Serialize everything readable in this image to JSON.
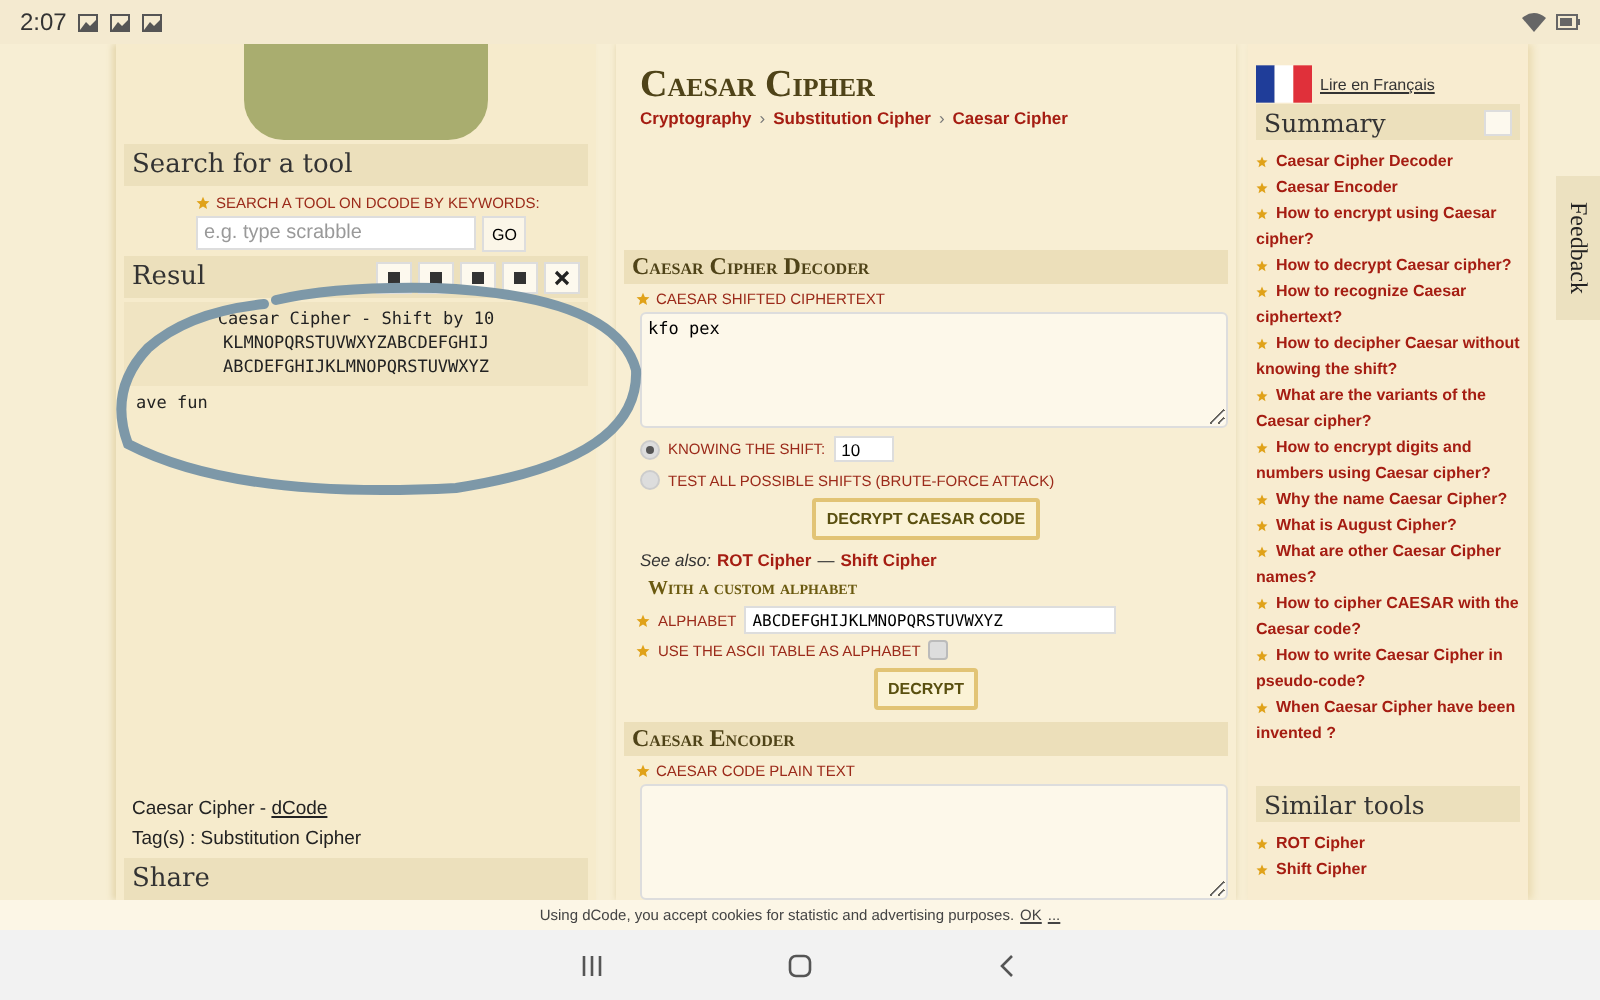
{
  "status_bar": {
    "time": "2:07"
  },
  "left": {
    "search": {
      "title": "Search for a tool",
      "label": "SEARCH A TOOL ON DCODE BY KEYWORDS:",
      "placeholder": "e.g. type scrabble",
      "button": "GO"
    },
    "results": {
      "title": "Resul",
      "output_lines": [
        "Caesar Cipher - Shift by 10",
        "KLMNOPQRSTUVWXYZABCDEFGHIJ",
        "ABCDEFGHIJKLMNOPQRSTUVWXYZ"
      ],
      "note": "ave fun"
    },
    "footer": {
      "text": "Caesar Cipher - ",
      "link": "dCode",
      "tags": "Tag(s) : Substitution Cipher"
    },
    "share": {
      "title": "Share"
    }
  },
  "main": {
    "title": "Caesar Cipher",
    "breadcrumb": [
      "Cryptography",
      "Substitution Cipher",
      "Caesar Cipher"
    ],
    "breadcrumb_separator": "›",
    "decoder": {
      "title": "Caesar Cipher Decoder",
      "ciphertext_label": "CAESAR SHIFTED CIPHERTEXT",
      "ciphertext_value": "kfo pex",
      "shift_options": [
        {
          "label": "KNOWING THE SHIFT:",
          "selected": true,
          "value": "10"
        },
        {
          "label": "TEST ALL POSSIBLE SHIFTS (BRUTE-FORCE ATTACK)",
          "selected": false
        }
      ],
      "button": "DECRYPT CAESAR CODE",
      "see_also_label": "See also:",
      "see_also_links": [
        "ROT Cipher",
        "Shift Cipher"
      ],
      "see_also_separator": "—",
      "custom_title": "With a custom alphabet",
      "alphabet_label": "ALPHABET",
      "alphabet_value": "ABCDEFGHIJKLMNOPQRSTUVWXYZ",
      "ascii_label": "USE THE ASCII TABLE AS ALPHABET",
      "ascii_checked": false,
      "custom_button": "DECRYPT"
    },
    "encoder": {
      "title": "Caesar Encoder",
      "label": "CAESAR CODE PLAIN TEXT"
    }
  },
  "right": {
    "language_link": "Lire en Français",
    "summary": {
      "title": "Summary",
      "items": [
        "Caesar Cipher Decoder",
        "Caesar Encoder",
        "How to encrypt using Caesar cipher?",
        "How to decrypt Caesar cipher?",
        "How to recognize Caesar ciphertext?",
        "How to decipher Caesar without knowing the shift?",
        "What are the variants of the Caesar cipher?",
        "How to encrypt digits and numbers using Caesar cipher?",
        "Why the name Caesar Cipher?",
        "What is August Cipher?",
        "What are other Caesar Cipher names?",
        "How to cipher CAESAR with the Caesar code?",
        "How to write Caesar Cipher in pseudo-code?",
        "When Caesar Cipher have been invented ?"
      ]
    },
    "similar": {
      "title": "Similar tools",
      "items": [
        "ROT Cipher",
        "Shift Cipher"
      ]
    }
  },
  "feedback": "Feedback",
  "cookie": {
    "text": "Using dCode, you accept cookies for statistic and advertising purposes.",
    "link": "OK",
    "more": "..."
  }
}
